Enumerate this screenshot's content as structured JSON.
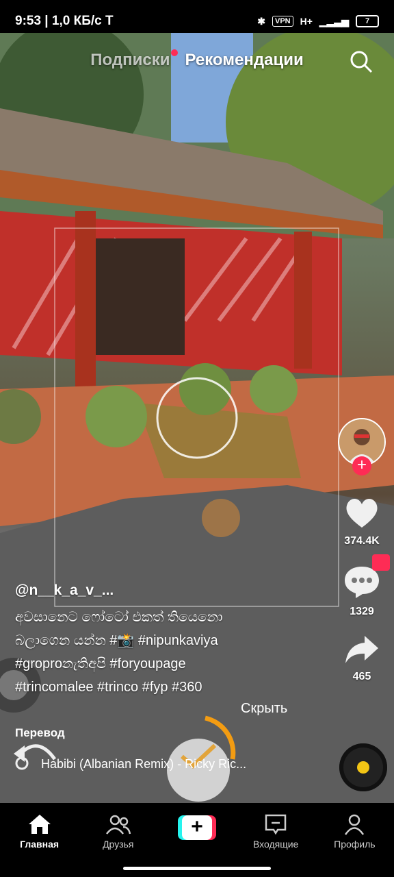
{
  "status_bar": {
    "time": "9:53 | 1,0 КБ/с",
    "carrier_glyph": "T",
    "vpn": "VPN",
    "network": "H+",
    "battery": "7"
  },
  "top_tabs": {
    "following": "Подписки",
    "for_you": "Рекомендации"
  },
  "rail": {
    "likes": "374.4K",
    "comments": "1329",
    "shares": "465"
  },
  "caption": {
    "username": "@n__k_a_v_...",
    "lines": [
      "අවසානෙට ෆෝටෝ එකත් තියෙනො",
      "බලාගෙන යන්න #📸 #nipunkaviya",
      "#groproනැතිඅපි #foryoupage",
      "#trincomalee #trinco #fyp #360"
    ],
    "hide": "Скрыть",
    "translate": "Перевод"
  },
  "music": {
    "title": "Habibi (Albanian Remix) - Ricky Ric..."
  },
  "bottom_nav": {
    "home": "Главная",
    "friends": "Друзья",
    "inbox": "Входящие",
    "profile": "Профиль"
  },
  "colors": {
    "accent_red": "#fe2c55",
    "accent_cyan": "#25f4ee",
    "disc_yellow": "#f3c515",
    "progress_orange": "#f39c12"
  },
  "icons": [
    "search-icon",
    "heart-icon",
    "comment-icon",
    "gift-icon",
    "share-icon",
    "music-disc-icon",
    "home-icon",
    "friends-icon",
    "plus-icon",
    "inbox-icon",
    "profile-icon",
    "undo-icon",
    "checkmark-icon"
  ]
}
